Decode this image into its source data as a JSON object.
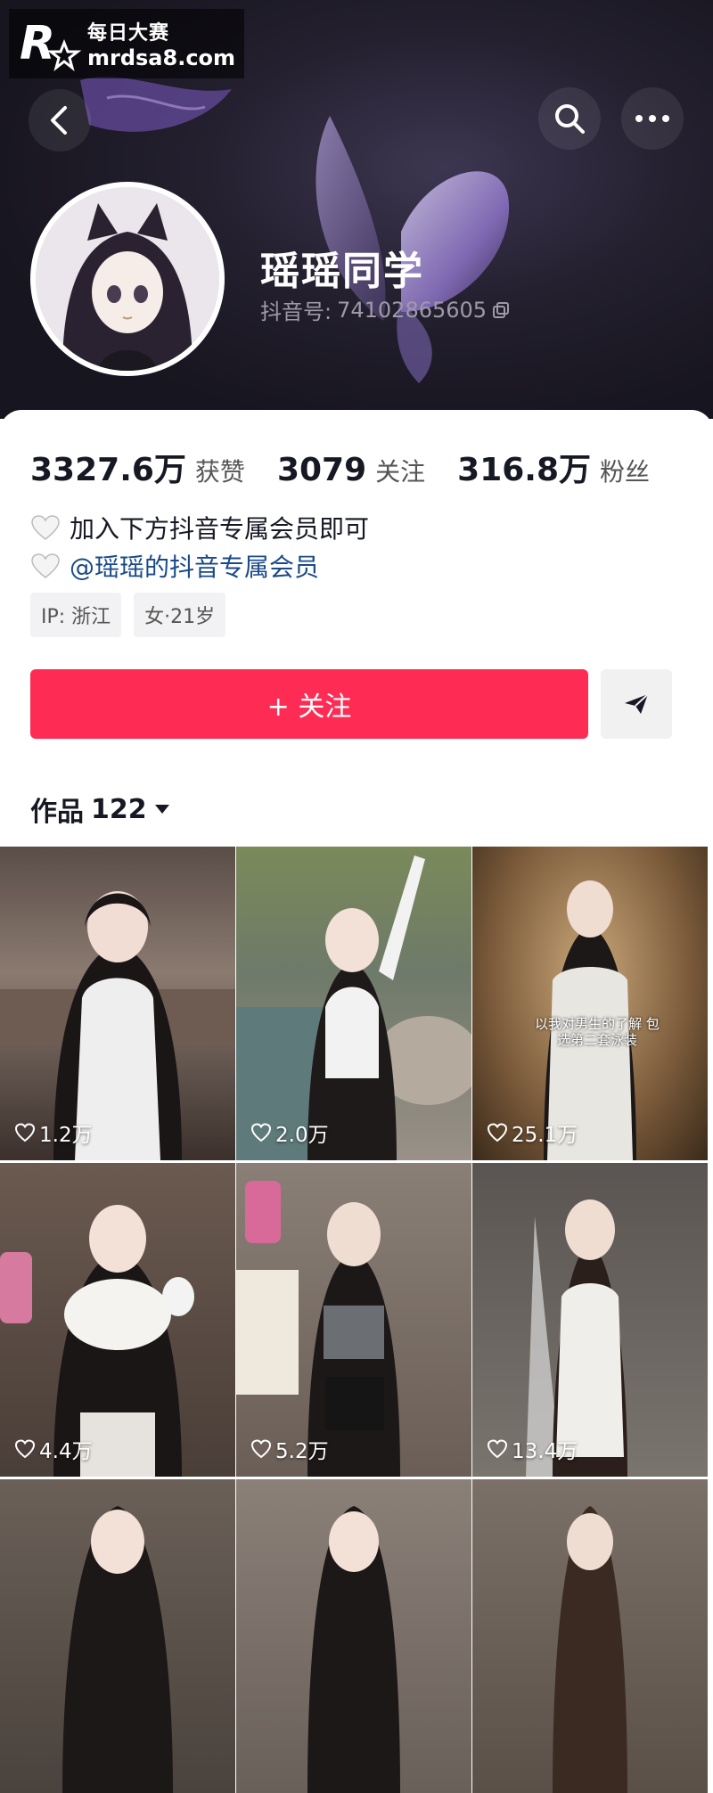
{
  "watermark": {
    "brand": "每日大赛",
    "url": "mrdsa8.com"
  },
  "profile": {
    "name": "瑶瑶同学",
    "id_label": "抖音号:",
    "id_value": "74102865605"
  },
  "stats": [
    {
      "value": "3327.6万",
      "label": "获赞"
    },
    {
      "value": "3079",
      "label": "关注"
    },
    {
      "value": "316.8万",
      "label": "粉丝"
    }
  ],
  "bio": {
    "line1": "加入下方抖音专属会员即可",
    "line2": "@瑶瑶的抖音专属会员"
  },
  "tags": {
    "ip": "IP: 浙江",
    "gender_age": "女·21岁"
  },
  "follow_button": "+ 关注",
  "works": {
    "label": "作品",
    "count": "122"
  },
  "videos": [
    {
      "likes": "1.2万"
    },
    {
      "likes": "2.0万"
    },
    {
      "likes": "25.1万",
      "caption": "以我对男生的了解 包选第二套泳装"
    },
    {
      "likes": "4.4万"
    },
    {
      "likes": "5.2万"
    },
    {
      "likes": "13.4万"
    },
    {},
    {},
    {}
  ],
  "colors": {
    "follow": "#fe2c55",
    "header_bg": "#1d1a26",
    "link": "#1a4a8a"
  },
  "icons": [
    "back-icon",
    "search-icon",
    "more-icon",
    "copy-icon",
    "heart-icon",
    "share-icon",
    "dropdown-icon"
  ]
}
